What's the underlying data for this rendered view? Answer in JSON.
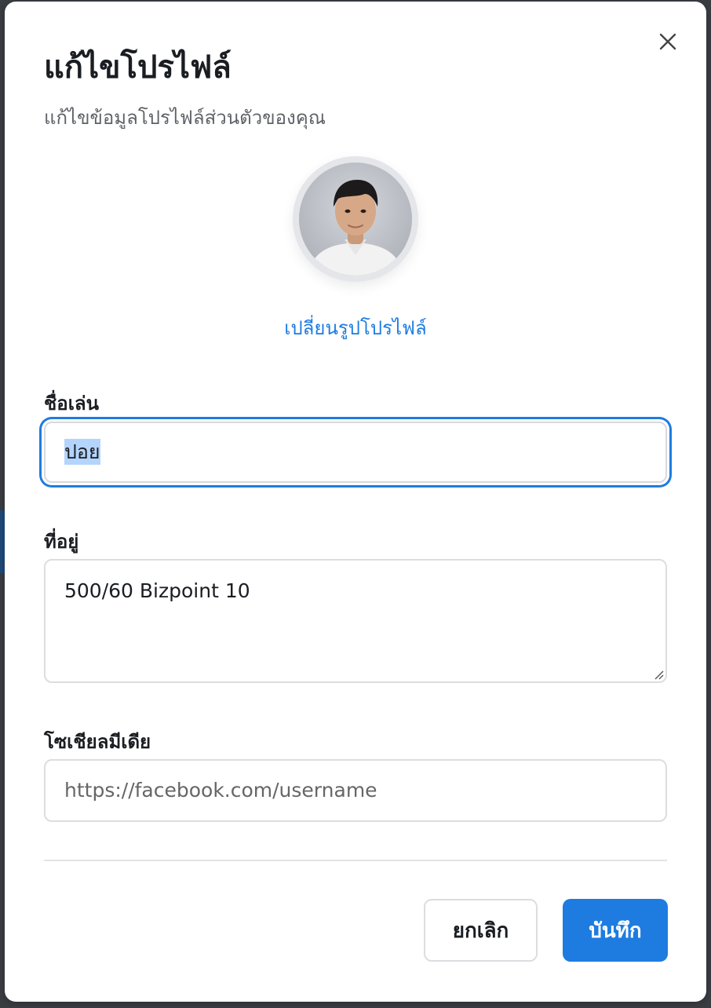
{
  "modal": {
    "title": "แก้ไขโปรไฟล์",
    "subtitle": "แก้ไขข้อมูลโปรไฟล์ส่วนตัวของคุณ",
    "close_icon": "close-icon"
  },
  "avatar": {
    "change_label": "เปลี่ยนรูปโปรไฟล์"
  },
  "fields": {
    "nickname": {
      "label": "ชื่อเล่น",
      "value": "ปอย",
      "selected": true
    },
    "address": {
      "label": "ที่อยู่",
      "value": "500/60 Bizpoint 10"
    },
    "social": {
      "label": "โซเชียลมีเดีย",
      "value": "",
      "placeholder": "https://facebook.com/username"
    }
  },
  "actions": {
    "cancel_label": "ยกเลิก",
    "save_label": "บันทึก"
  },
  "colors": {
    "accent": "#1e7ce0",
    "selection": "#b3d4fc",
    "text": "#1a1d21",
    "muted": "#5f6368"
  }
}
